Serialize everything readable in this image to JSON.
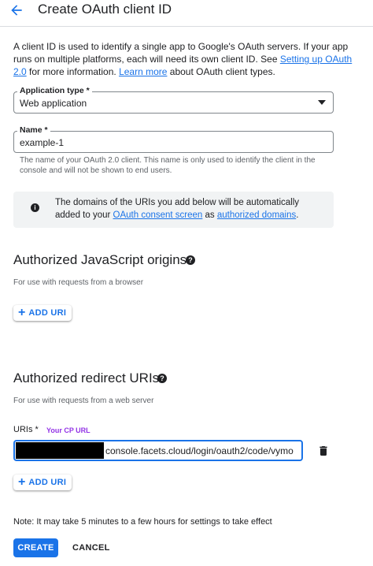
{
  "header": {
    "title": "Create OAuth client ID"
  },
  "intro": {
    "text_before": "A client ID is used to identify a single app to Google's OAuth servers. If your app runs on multiple platforms, each will need its own client ID. See ",
    "link1": "Setting up OAuth 2.0",
    "text_middle": " for more information. ",
    "link2": "Learn more",
    "text_after": " about OAuth client types."
  },
  "application_type": {
    "label": "Application type *",
    "value": "Web application"
  },
  "name_field": {
    "label": "Name *",
    "value": "example-1",
    "hint": "The name of your OAuth 2.0 client. This name is only used to identify the client in the console and will not be shown to end users."
  },
  "info_box": {
    "text_before": "The domains of the URIs you add below will be automatically added to your ",
    "link1": "OAuth consent screen",
    "text_middle": " as ",
    "link2": "authorized domains",
    "text_after": "."
  },
  "js_origins": {
    "title": "Authorized JavaScript origins",
    "subtitle": "For use with requests from a browser",
    "add_label": "ADD URI"
  },
  "redirect_uris": {
    "title": "Authorized redirect URIs",
    "subtitle": "For use with requests from a web server",
    "uris_label": "URIs *",
    "annotation": "Your CP URL",
    "uri_value": "console.facets.cloud/login/oauth2/code/vymo",
    "add_label": "ADD URI"
  },
  "note": "Note: It may take 5 minutes to a few hours for settings to take effect",
  "actions": {
    "create": "CREATE",
    "cancel": "CANCEL"
  },
  "colors": {
    "primary": "#1a73e8",
    "annotation": "#9334e6",
    "info_bg": "#f1f3f4"
  },
  "icons": {
    "back": "arrow-back-icon",
    "dropdown": "dropdown-arrow-icon",
    "info": "info-icon",
    "help": "help-icon",
    "add": "plus-icon",
    "delete": "trash-icon"
  }
}
